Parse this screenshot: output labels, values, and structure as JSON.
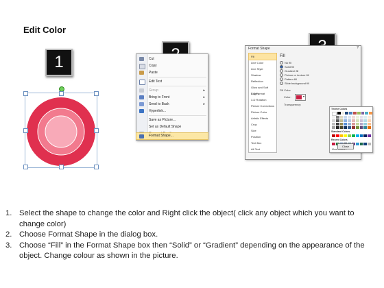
{
  "title": "Edit Color",
  "steps": [
    {
      "number": "1"
    },
    {
      "number": "2"
    },
    {
      "number": "3"
    }
  ],
  "context_menu": {
    "items": [
      {
        "label": "Cut",
        "icon": "scissors-icon",
        "disabled": false,
        "submenu": false
      },
      {
        "label": "Copy",
        "icon": "copy-icon",
        "disabled": false,
        "submenu": false
      },
      {
        "label": "Paste",
        "icon": "paste-icon",
        "disabled": false,
        "submenu": false
      },
      {
        "label": "Edit Text",
        "icon": "edit-text-icon",
        "disabled": false,
        "submenu": false
      },
      {
        "label": "Group",
        "icon": "group-icon",
        "disabled": true,
        "submenu": true
      },
      {
        "label": "Bring to Front",
        "icon": "bring-front-icon",
        "disabled": false,
        "submenu": true
      },
      {
        "label": "Send to Back",
        "icon": "send-back-icon",
        "disabled": false,
        "submenu": true
      },
      {
        "label": "Hyperlink...",
        "icon": "hyperlink-icon",
        "disabled": false,
        "submenu": false
      },
      {
        "label": "Save as Picture...",
        "icon": "",
        "disabled": false,
        "submenu": false
      },
      {
        "label": "Set as Default Shape",
        "icon": "",
        "disabled": false,
        "submenu": false
      },
      {
        "label": "Size and Position...",
        "icon": "size-icon",
        "disabled": false,
        "submenu": false
      },
      {
        "label": "Format Shape...",
        "icon": "format-shape-icon",
        "disabled": false,
        "submenu": false,
        "highlighted": true
      }
    ]
  },
  "dialog": {
    "title": "Format Shape",
    "close_glyph": "?",
    "categories": [
      "Fill",
      "Line Color",
      "Line Style",
      "Shadow",
      "Reflection",
      "Glow and Soft Edges",
      "3-D Format",
      "3-D Rotation",
      "Picture Corrections",
      "Picture Color",
      "Artistic Effects",
      "Crop",
      "Size",
      "Position",
      "Text Box",
      "Alt Text"
    ],
    "selected_category": "Fill",
    "fill_heading": "Fill",
    "fill_options": [
      "No fill",
      "Solid fill",
      "Gradient fill",
      "Picture or texture fill",
      "Pattern fill",
      "Slide background fill"
    ],
    "selected_fill": "Solid fill",
    "fill_color_heading": "Fill Color",
    "color_label": "Color:",
    "transparency_label": "Transparency:",
    "palette_theme_heading": "Theme Colors",
    "palette_standard_heading": "Standard Colors",
    "palette_recent_heading": "Recent Colors",
    "palette_more": "More Colors...",
    "close_button": "Close",
    "current_color": "#c71f43"
  },
  "instructions": [
    {
      "num": "1.",
      "text": "Select the shape to change the color and Right click the object( click any object which you want to change color)"
    },
    {
      "num": "2.",
      "text": "Choose Format Shape in the dialog box."
    },
    {
      "num": "3.",
      "text": "Choose “Fill” in the Format Shape box then “Solid” or “Gradient” depending on the appearance of the object. Change colour as shown in the picture."
    }
  ],
  "colors": {
    "ring_outer": "#e0304f",
    "ring_middle": "#f27a8e",
    "ring_inner": "#f8aab8",
    "menu_highlight": "#fce7a5"
  }
}
